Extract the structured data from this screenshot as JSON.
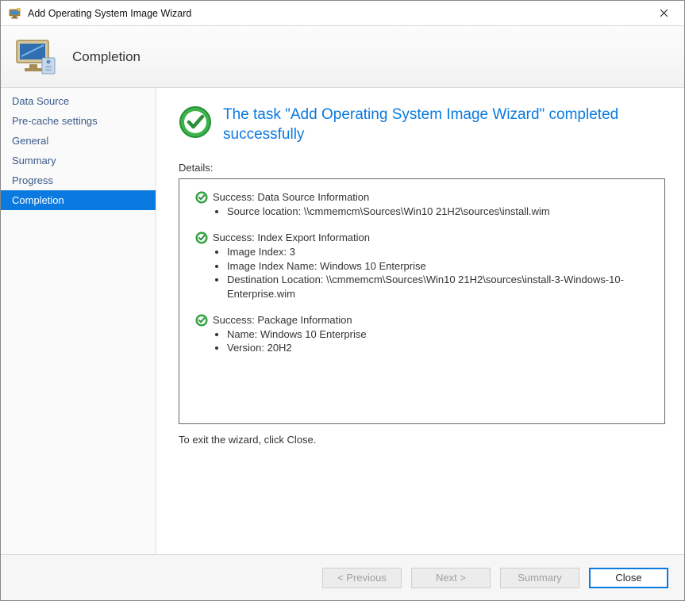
{
  "window": {
    "title": "Add Operating System Image Wizard"
  },
  "banner": {
    "step_title": "Completion"
  },
  "sidebar": {
    "items": [
      {
        "label": "Data Source",
        "active": false
      },
      {
        "label": "Pre-cache settings",
        "active": false
      },
      {
        "label": "General",
        "active": false
      },
      {
        "label": "Summary",
        "active": false
      },
      {
        "label": "Progress",
        "active": false
      },
      {
        "label": "Completion",
        "active": true
      }
    ]
  },
  "main": {
    "headline": "The task \"Add Operating System Image Wizard\" completed successfully",
    "details_label": "Details:",
    "sections": [
      {
        "title": "Success: Data Source Information",
        "items": [
          "Source location: \\\\cmmemcm\\Sources\\Win10 21H2\\sources\\install.wim"
        ]
      },
      {
        "title": "Success: Index Export Information",
        "items": [
          "Image Index: 3",
          "Image Index Name: Windows 10 Enterprise",
          "Destination Location: \\\\cmmemcm\\Sources\\Win10 21H2\\sources\\install-3-Windows-10-Enterprise.wim"
        ]
      },
      {
        "title": "Success: Package Information",
        "items": [
          "Name: Windows 10 Enterprise",
          "Version: 20H2"
        ]
      }
    ],
    "exit_text": "To exit the wizard, click Close."
  },
  "footer": {
    "previous_label": "< Previous",
    "next_label": "Next >",
    "summary_label": "Summary",
    "close_label": "Close"
  }
}
